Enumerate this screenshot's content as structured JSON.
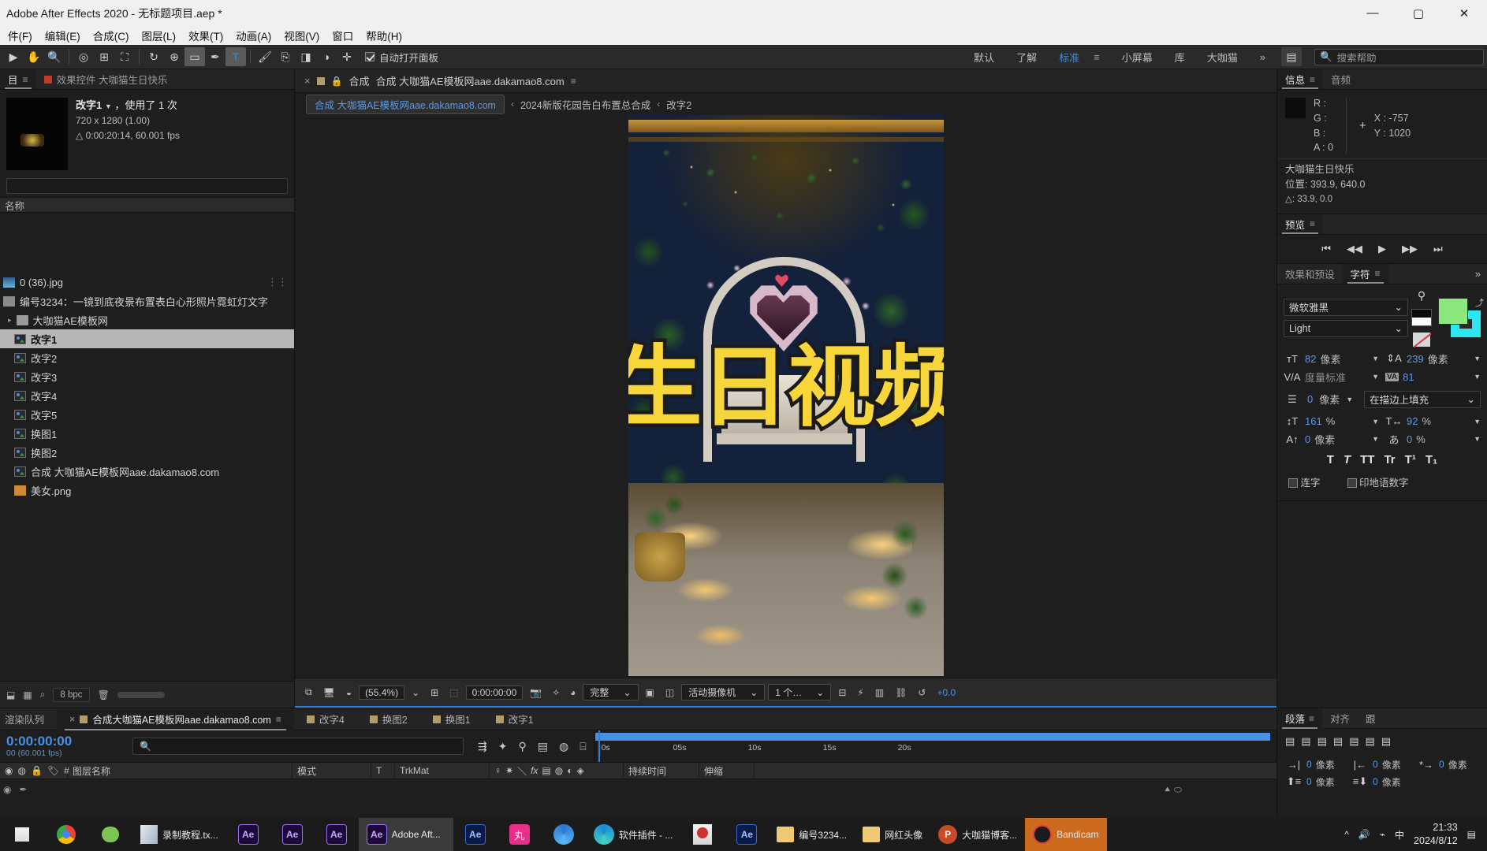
{
  "window": {
    "title": "Adobe After Effects 2020 - 无标题项目.aep *",
    "minimize": "—",
    "maximize": "▢",
    "close": "✕"
  },
  "menu": [
    "件(F)",
    "编辑(E)",
    "合成(C)",
    "图层(L)",
    "效果(T)",
    "动画(A)",
    "视图(V)",
    "窗口",
    "帮助(H)"
  ],
  "toolbar": {
    "auto_panel_label": "自动打开面板",
    "workspaces": [
      "默认",
      "了解",
      "标准",
      "小屏幕",
      "库",
      "大咖猫"
    ],
    "active_workspace": "标准",
    "overflow": "»",
    "search_placeholder": "搜索帮助"
  },
  "project": {
    "tabs": [
      {
        "label": "目",
        "active": true
      },
      {
        "label": "效果控件 大咖猫生日快乐",
        "active": false
      }
    ],
    "header": {
      "name": "改字1",
      "usage": "，使用了 1 次",
      "dimensions": "720 x 1280 (1.00)",
      "duration": "0:00:20:14, 60.001 fps"
    },
    "column_header": "名称",
    "items": [
      {
        "label": "0 (36).jpg",
        "icon": "image-icon",
        "selected": false,
        "indent": 0
      },
      {
        "label": "编号3234：一镜到底夜景布置表白心形照片霓虹灯文字",
        "icon": "square-icon",
        "selected": false,
        "indent": 0
      },
      {
        "label": "大咖猫AE模板网",
        "icon": "folder-icon",
        "selected": false,
        "indent": 1
      },
      {
        "label": "改字1",
        "icon": "comp-icon",
        "selected": true,
        "indent": 1
      },
      {
        "label": "改字2",
        "icon": "comp-icon",
        "selected": false,
        "indent": 1
      },
      {
        "label": "改字3",
        "icon": "comp-icon",
        "selected": false,
        "indent": 1
      },
      {
        "label": "改字4",
        "icon": "comp-icon",
        "selected": false,
        "indent": 1
      },
      {
        "label": "改字5",
        "icon": "comp-icon",
        "selected": false,
        "indent": 1
      },
      {
        "label": "换图1",
        "icon": "comp-icon",
        "selected": false,
        "indent": 1
      },
      {
        "label": "换图2",
        "icon": "comp-icon",
        "selected": false,
        "indent": 1
      },
      {
        "label": "合成 大咖猫AE模板网aae.dakamao8.com",
        "icon": "comp-icon",
        "selected": false,
        "indent": 1
      },
      {
        "label": "美女.png",
        "icon": "png-icon",
        "selected": false,
        "indent": 1
      }
    ],
    "footer": {
      "bpc": "8 bpc"
    }
  },
  "comp": {
    "tab_close": "×",
    "tab_title_prefix": "合成",
    "tab_title_main": "合成 大咖猫AE模板网aae.dakamao8.com",
    "breadcrumb": {
      "chip": "合成 大咖猫AE模板网aae.dakamao8.com",
      "items": [
        "2024新版花园告白布置总合成",
        "改字2"
      ],
      "sep": "‹"
    },
    "overlay_text": "花园生日视频制作",
    "bottombar": {
      "zoom": "(55.4%)",
      "time": "0:00:00:00",
      "quality": "完整",
      "camera": "活动摄像机",
      "views": "1 个…",
      "exposure": "+0.0"
    }
  },
  "right": {
    "info": {
      "tabs": [
        {
          "label": "信息",
          "active": true
        },
        {
          "label": "音频",
          "active": false
        }
      ],
      "r_label": "R :",
      "g_label": "G :",
      "b_label": "B :",
      "a_label": "A : 0",
      "x_label": "X : -757",
      "y_label": "Y : 1020",
      "layer_name": "大咖猫生日快乐",
      "position_label": "位置: 393.9, 640.0",
      "delta_label": "△: 33.9, 0.0"
    },
    "preview": {
      "title": "预览",
      "buttons": [
        "⏮",
        "◀◀",
        "▶",
        "▶▶",
        "⏭"
      ]
    },
    "character": {
      "tabs": [
        {
          "label": "效果和预设",
          "active": false
        },
        {
          "label": "字符",
          "active": true
        }
      ],
      "overflow": "»",
      "font_family": "微软雅黑",
      "font_style": "Light",
      "font_size": "82",
      "font_size_unit": "像素",
      "leading": "239",
      "leading_unit": "像素",
      "kerning": "度量标准",
      "tracking": "81",
      "stroke_width": "0",
      "stroke_width_unit": "像素",
      "stroke_mode": "在描边上填充",
      "vertical_scale": "161",
      "vertical_scale_unit": "%",
      "horizontal_scale": "92",
      "horizontal_scale_unit": "%",
      "baseline_shift": "0",
      "baseline_shift_unit": "像素",
      "tsume": "0",
      "tsume_unit": "%",
      "styles": [
        "T",
        "T",
        "TT",
        "Tr",
        "T¹",
        "T₁"
      ],
      "ligature_label": "连字",
      "hindi_label": "印地语数字",
      "fill_color": "#8ce87e",
      "stroke_color": "#2ee6f0"
    }
  },
  "timeline": {
    "tabs": [
      {
        "label": "渲染队列",
        "active": false,
        "swatch": false
      },
      {
        "label": "合成大咖猫AE模板网aae.dakamao8.com",
        "active": true,
        "swatch": true
      },
      {
        "label": "改字4",
        "active": false,
        "swatch": true
      },
      {
        "label": "换图2",
        "active": false,
        "swatch": true
      },
      {
        "label": "换图1",
        "active": false,
        "swatch": true
      },
      {
        "label": "改字1",
        "active": false,
        "swatch": true
      }
    ],
    "current_time": "0:00:00:00",
    "fps_note": "00 (60.001 fps)",
    "search_placeholder": "",
    "columns": [
      "#",
      "图层名称",
      "模式",
      "T",
      "TrkMat",
      "持续时间",
      "伸缩"
    ],
    "ruler_ticks": [
      "0s",
      "05s",
      "10s",
      "15s",
      "20s"
    ]
  },
  "bottom_right": {
    "tabs": [
      {
        "label": "段落",
        "active": true
      },
      {
        "label": "对齐",
        "active": false
      },
      {
        "label": "跟",
        "active": false
      }
    ],
    "values": [
      {
        "num": "0",
        "unit": "像素"
      },
      {
        "num": "0",
        "unit": "像素"
      },
      {
        "num": "0",
        "unit": "像素"
      },
      {
        "num": "0",
        "unit": "像素"
      },
      {
        "num": "0",
        "unit": "像素"
      }
    ]
  },
  "taskbar": {
    "apps": [
      {
        "label": "录制教程.tx...",
        "type": "doc"
      },
      {
        "label": "",
        "type": "ae"
      },
      {
        "label": "",
        "type": "ae"
      },
      {
        "label": "",
        "type": "ae"
      },
      {
        "label": "Adobe Aft...",
        "type": "ae",
        "active": true
      },
      {
        "label": "",
        "type": "ae2"
      },
      {
        "label": "",
        "type": "pink"
      },
      {
        "label": "",
        "type": "blue"
      },
      {
        "label": "软件插件 - ...",
        "type": "edge"
      },
      {
        "label": "",
        "type": "red"
      },
      {
        "label": "",
        "type": "ae2"
      },
      {
        "label": "编号3234...",
        "type": "folder"
      },
      {
        "label": "网红头像",
        "type": "folder"
      },
      {
        "label": "大咖猫博客...",
        "type": "ppt"
      },
      {
        "label": "Bandicam",
        "type": "bandicam",
        "highlight": true
      }
    ],
    "tray": {
      "ime": "中",
      "time": "21:33",
      "date": "2024/8/12"
    }
  }
}
